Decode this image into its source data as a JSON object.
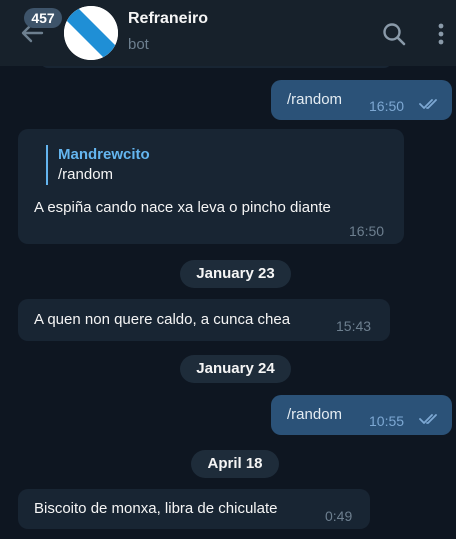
{
  "header": {
    "unread_count": "457",
    "title": "Refraneiro",
    "subtitle": "bot"
  },
  "messages": [
    {
      "type": "out",
      "text": "/random",
      "time": "16:50"
    },
    {
      "type": "in",
      "reply_author": "Mandrewcito",
      "reply_text": "/random",
      "text": "A espiña cando nace xa leva o pincho diante",
      "time": "16:50"
    },
    {
      "type": "in",
      "text": "A quen non quere caldo, a cunca chea",
      "time": "15:43"
    },
    {
      "type": "out",
      "text": "/random",
      "time": "10:55"
    },
    {
      "type": "in",
      "text": "Biscoito de monxa, libra de chiculate",
      "time": "0:49"
    }
  ],
  "dates": [
    "January 23",
    "January 24",
    "April 18"
  ],
  "colors": {
    "background": "#0e1621",
    "header": "#17212b",
    "incoming_bubble": "#182533",
    "outgoing_bubble": "#2b5278",
    "accent": "#64b5ef"
  }
}
